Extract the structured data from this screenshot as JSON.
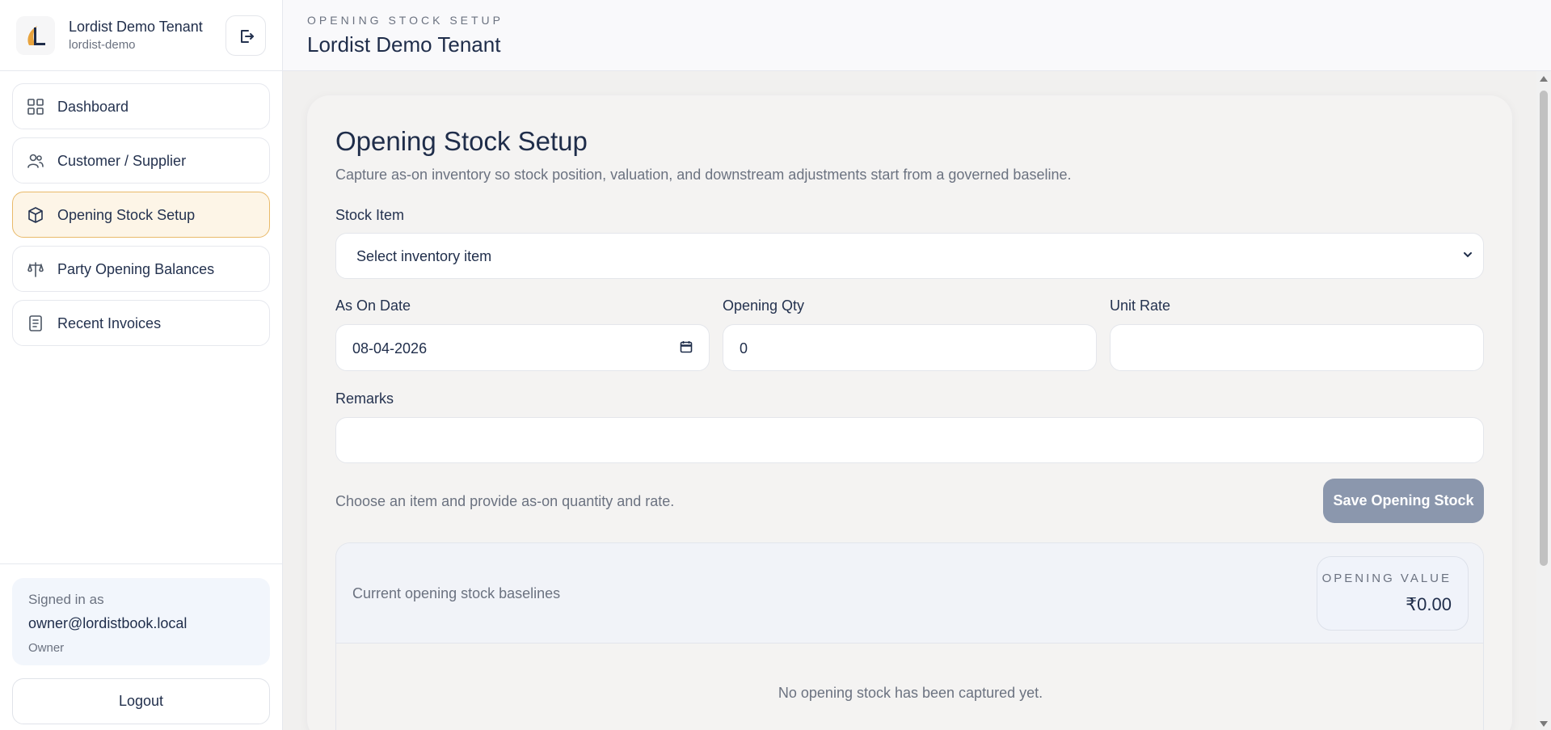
{
  "brand": {
    "name": "Lordist Demo Tenant",
    "slug": "lordist-demo"
  },
  "nav": {
    "items": [
      {
        "label": "Dashboard",
        "icon": "grid-icon"
      },
      {
        "label": "Customer / Supplier",
        "icon": "users-icon"
      },
      {
        "label": "Opening Stock Setup",
        "icon": "box-icon",
        "active": true
      },
      {
        "label": "Party Opening Balances",
        "icon": "scale-icon"
      },
      {
        "label": "Recent Invoices",
        "icon": "receipt-icon"
      }
    ]
  },
  "user": {
    "signed_in_label": "Signed in as",
    "email": "owner@lordistbook.local",
    "role": "Owner",
    "logout_label": "Logout"
  },
  "header": {
    "eyebrow": "OPENING STOCK SETUP",
    "title": "Lordist Demo Tenant"
  },
  "form": {
    "title": "Opening Stock Setup",
    "description": "Capture as-on inventory so stock position, valuation, and downstream adjustments start from a governed baseline.",
    "stock_item_label": "Stock Item",
    "stock_item_value": "Select inventory item",
    "as_on_date_label": "As On Date",
    "as_on_date_value": "08-04-2026",
    "opening_qty_label": "Opening Qty",
    "opening_qty_value": "0",
    "unit_rate_label": "Unit Rate",
    "unit_rate_value": "",
    "remarks_label": "Remarks",
    "remarks_value": "",
    "hint": "Choose an item and provide as-on quantity and rate.",
    "save_label": "Save Opening Stock"
  },
  "baselines": {
    "title": "Current opening stock baselines",
    "value_label": "OPENING VALUE",
    "value_amount": "₹0.00",
    "empty_message": "No opening stock has been captured yet."
  },
  "colors": {
    "accent_active_bg": "#fdf5e7",
    "accent_active_border": "#e9ba6a",
    "primary_text": "#1f2d4a",
    "disabled_button": "#8b97ad"
  }
}
